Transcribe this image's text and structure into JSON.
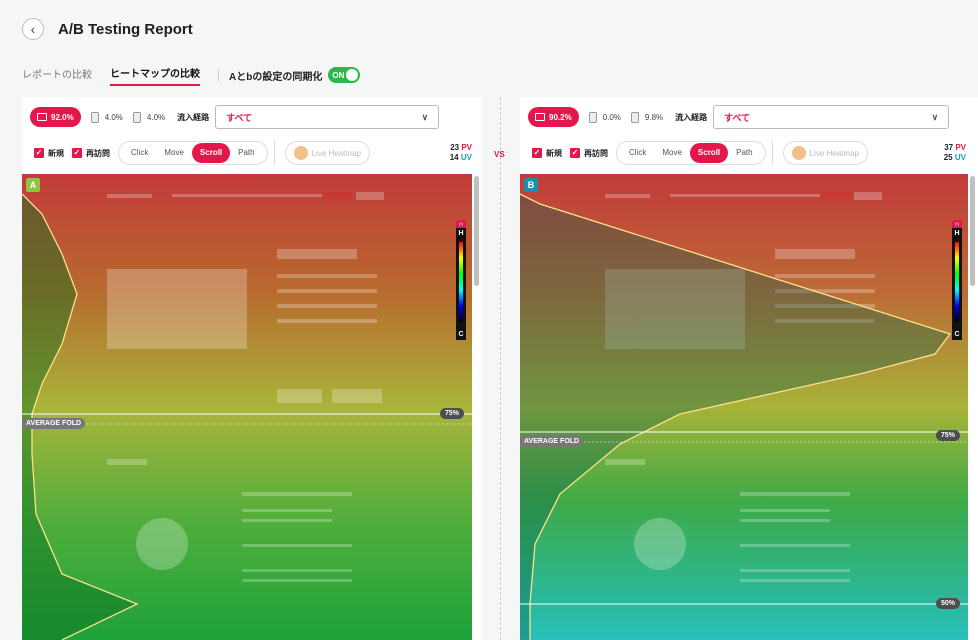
{
  "header": {
    "title": "A/B Testing Report",
    "back_icon": "chevron-left-icon"
  },
  "tabs": {
    "items": [
      {
        "label": "レポートの比較",
        "active": false
      },
      {
        "label": "ヒートマップの比較",
        "active": true
      }
    ],
    "sync_label": "Aとbの設定の同期化",
    "sync_toggle": "ON"
  },
  "vs_label": "VS",
  "panels": {
    "a": {
      "variant": "A",
      "variant_color": "#8cc63f",
      "devices": {
        "pc": "92.0%",
        "tablet": "4.0%",
        "mobile": "4.0%"
      },
      "flow_label": "流入経路",
      "flow_value": "すべて",
      "filters": {
        "new": "新規",
        "returning": "再訪問"
      },
      "modes": [
        "Click",
        "Move",
        "Scroll",
        "Path"
      ],
      "active_mode": "Scroll",
      "live_heatmap": "Live Heatmap",
      "pv": "23",
      "pv_unit": "PV",
      "uv": "14",
      "uv_unit": "UV",
      "average_fold": "AVERAGE FOLD",
      "pct_75": "75%",
      "legend_high": "H",
      "legend_low": "C",
      "scroll_fraction_at_fold": 0.75
    },
    "b": {
      "variant": "B",
      "variant_color": "#1a8fb0",
      "devices": {
        "pc": "90.2%",
        "tablet": "0.0%",
        "mobile": "9.8%"
      },
      "flow_label": "流入経路",
      "flow_value": "すべて",
      "filters": {
        "new": "新規",
        "returning": "再訪問"
      },
      "modes": [
        "Click",
        "Move",
        "Scroll",
        "Path"
      ],
      "active_mode": "Scroll",
      "live_heatmap": "Live Heatmap",
      "pv": "37",
      "pv_unit": "PV",
      "uv": "25",
      "uv_unit": "UV",
      "average_fold": "AVERAGE FOLD",
      "pct_75": "75%",
      "pct_50": "50%",
      "legend_high": "H",
      "legend_low": "C",
      "scroll_fraction_at_fold": 0.75
    }
  },
  "colors": {
    "accent": "#e4174d",
    "uv": "#18a0b6",
    "toggle_on": "#2bb84a"
  }
}
